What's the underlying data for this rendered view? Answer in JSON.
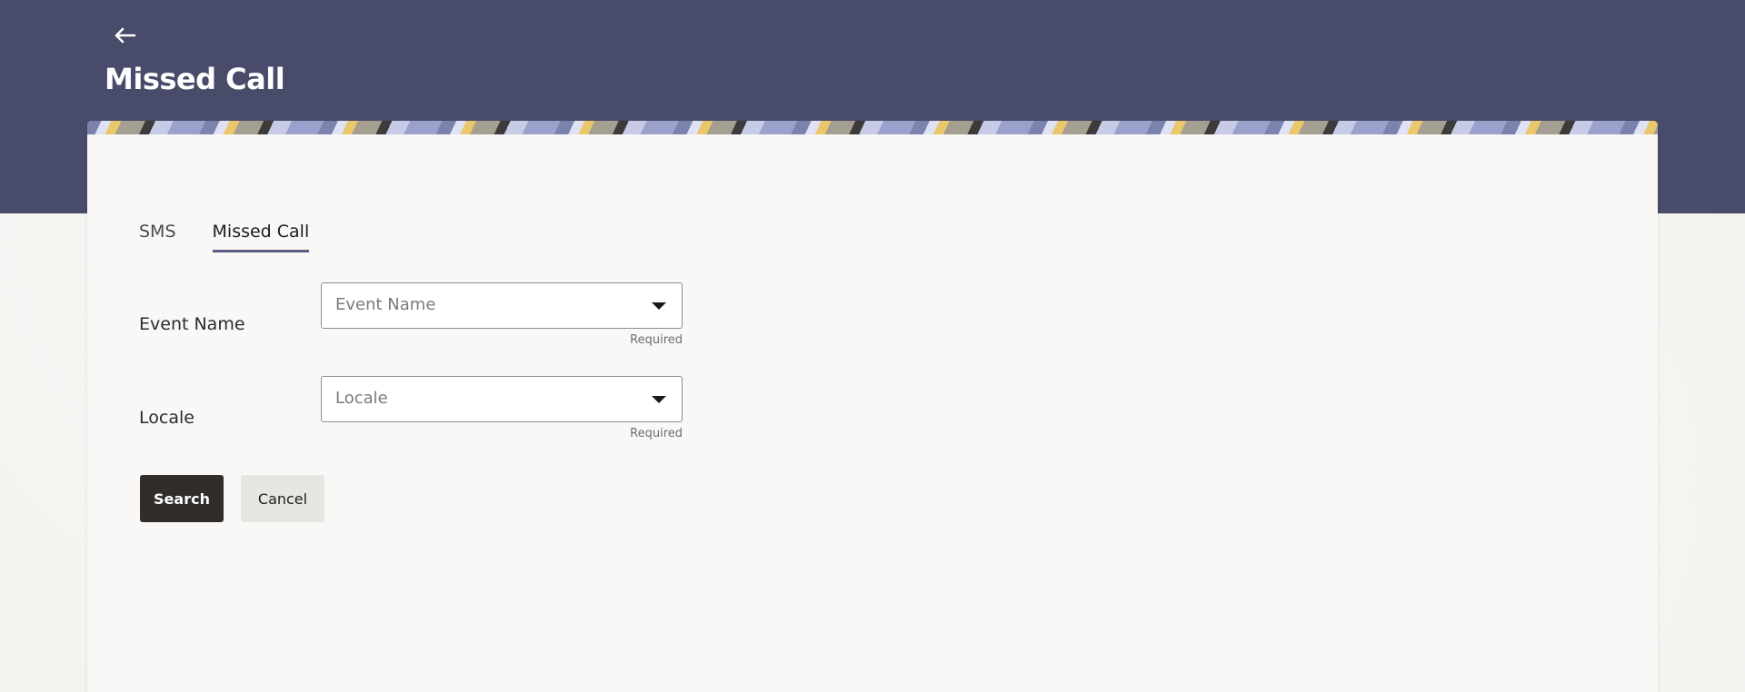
{
  "header": {
    "back_icon": "arrow-left-icon",
    "title": "Missed Call"
  },
  "tabs": [
    {
      "label": "SMS",
      "active": false
    },
    {
      "label": "Missed Call",
      "active": true
    }
  ],
  "form": {
    "event_name": {
      "label": "Event Name",
      "placeholder": "Event Name",
      "helper": "Required"
    },
    "locale": {
      "label": "Locale",
      "placeholder": "Locale",
      "helper": "Required"
    }
  },
  "actions": {
    "search_label": "Search",
    "cancel_label": "Cancel"
  },
  "colors": {
    "header_bg": "#484b69",
    "card_bg": "#f9f8f6",
    "primary_button": "#312d2a",
    "tab_underline": "#5a5e82"
  }
}
